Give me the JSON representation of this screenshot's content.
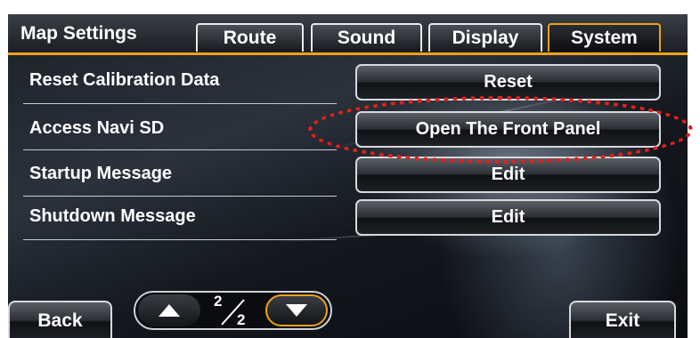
{
  "header": {
    "title": "Map Settings",
    "tabs": [
      {
        "label": "Route",
        "active": false
      },
      {
        "label": "Sound",
        "active": false
      },
      {
        "label": "Display",
        "active": false
      },
      {
        "label": "System",
        "active": true
      }
    ]
  },
  "rows": [
    {
      "label": "Reset Calibration Data",
      "button": "Reset"
    },
    {
      "label": "Access Navi SD",
      "button": "Open The Front Panel"
    },
    {
      "label": "Startup Message",
      "button": "Edit"
    },
    {
      "label": "Shutdown Message",
      "button": "Edit"
    }
  ],
  "bottom": {
    "back_label": "Back",
    "exit_label": "Exit",
    "page_current": "2",
    "page_total": "2"
  },
  "colors": {
    "accent": "#f0a21a",
    "highlight": "#e2201c"
  },
  "icons": {
    "page_up": "triangle-up-icon",
    "page_down": "triangle-down-icon"
  }
}
